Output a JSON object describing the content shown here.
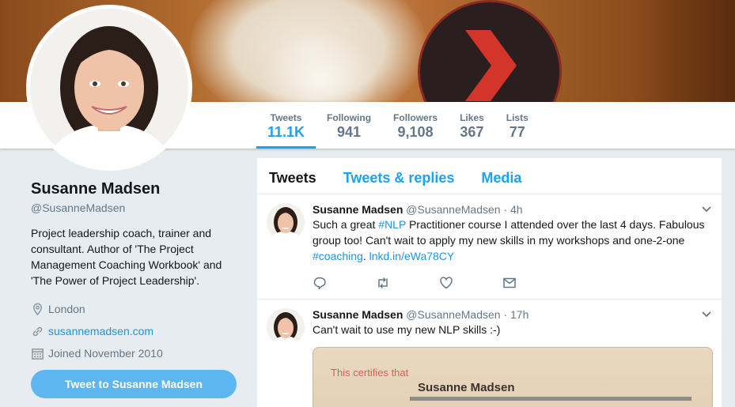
{
  "profile": {
    "name": "Susanne Madsen",
    "handle": "@SusanneMadsen",
    "bio": "Project leadership coach, trainer and consultant. Author of 'The Project Management Coaching Workbook' and 'The Power of Project Leadership'.",
    "location": "London",
    "website": "susannemadsen.com",
    "joined": "Joined November 2010",
    "tweet_to_label": "Tweet to Susanne Madsen"
  },
  "stats": [
    {
      "label": "Tweets",
      "value": "11.1K",
      "active": true
    },
    {
      "label": "Following",
      "value": "941"
    },
    {
      "label": "Followers",
      "value": "9,108"
    },
    {
      "label": "Likes",
      "value": "367"
    },
    {
      "label": "Lists",
      "value": "77"
    }
  ],
  "timeline": {
    "tabs": [
      "Tweets",
      "Tweets & replies",
      "Media"
    ],
    "tweets": [
      {
        "name": "Susanne Madsen",
        "handle": "@SusanneMadsen",
        "dot": "·",
        "time": "4h",
        "text_1": "Such a great ",
        "hashtag_1": "#NLP",
        "text_2": " Practitioner course I attended over the last 4 days. Fabulous group too! Can't wait to apply my new skills in my workshops and one-2-one ",
        "hashtag_2": "#coaching",
        "text_3": ". ",
        "link": "lnkd.in/eWa78CY"
      },
      {
        "name": "Susanne Madsen",
        "handle": "@SusanneMadsen",
        "dot": "·",
        "time": "17h",
        "text": "Can't wait to use my new NLP skills :-)",
        "photo_line1": "This certifies that",
        "photo_line2": "Susanne Madsen"
      }
    ]
  },
  "colors": {
    "accent": "#1da1f2",
    "link": "#1b95e0",
    "muted": "#657786",
    "button": "#5db6ef"
  },
  "icons": [
    "location-icon",
    "link-icon",
    "calendar-icon",
    "reply-icon",
    "retweet-icon",
    "like-icon",
    "message-icon",
    "caret-down-icon"
  ]
}
